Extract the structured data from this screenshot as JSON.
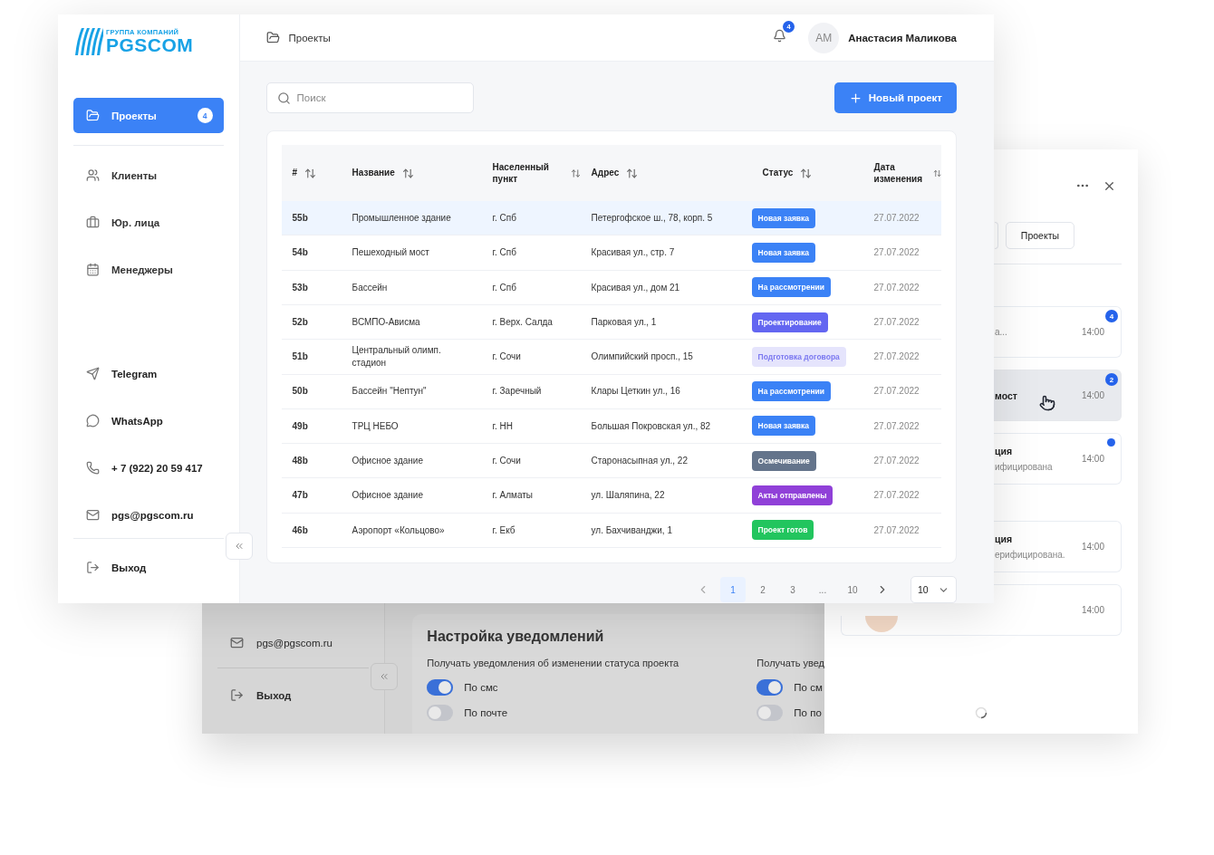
{
  "back_window": {
    "sidebar": {
      "email": "pgs@pgscom.ru",
      "logout": "Выход"
    },
    "settings": {
      "title": "Настройка уведомлений",
      "columns": [
        {
          "caption": "Получать уведомления об изменении статуса проекта",
          "toggles": [
            {
              "label": "По смс",
              "on": true
            },
            {
              "label": "По почте",
              "on": false
            }
          ]
        },
        {
          "caption": "Получать увед",
          "toggles": [
            {
              "label": "По см",
              "on": true
            },
            {
              "label": "По по",
              "on": false
            }
          ]
        }
      ]
    }
  },
  "notifications_panel": {
    "tab": "Проекты",
    "groups": [
      {
        "items": [
          {
            "text": "а...",
            "time": "14:00",
            "badge": "4",
            "unread": false,
            "hovered": false
          },
          {
            "title": "мост",
            "time": "14:00",
            "badge": "2",
            "unread": false,
            "hovered": true
          },
          {
            "title": "ция",
            "text": "ифицирована",
            "time": "14:00",
            "unread": true,
            "hovered": false
          }
        ]
      },
      {
        "items": [
          {
            "title": "ция",
            "text": "ерифицирована.",
            "time": "14:00",
            "unread": false,
            "hovered": false
          },
          {
            "time": "14:00",
            "unread": false,
            "hovered": false
          }
        ]
      }
    ]
  },
  "main_window": {
    "logo": {
      "caption": "ГРУППА КОМПАНИЙ",
      "name": "PGSCOM"
    },
    "sidebar": {
      "nav": [
        {
          "label": "Проекты",
          "badge": "4",
          "selected": true
        },
        {
          "label": "Клиенты",
          "selected": false
        },
        {
          "label": "Юр. лица",
          "selected": false
        },
        {
          "label": "Менеджеры",
          "selected": false
        }
      ],
      "contacts": [
        "Telegram",
        "WhatsApp",
        "+ 7 (922) 20 59 417",
        "pgs@pgscom.ru"
      ],
      "logout": "Выход"
    },
    "header": {
      "breadcrumb": "Проекты",
      "notifications_count": "4",
      "avatar_initials": "АМ",
      "user_name": "Анастасия Маликова"
    },
    "search": {
      "placeholder": "Поиск"
    },
    "new_button": "Новый проект",
    "table": {
      "columns": [
        "#",
        "Название",
        "Населенный пункт",
        "Адрес",
        "Статус",
        "Дата изменения"
      ],
      "rows": [
        {
          "id": "55b",
          "name": "Промышленное здание",
          "city": "г. Спб",
          "address": "Петергофское ш., 78, корп. 5",
          "status": {
            "label": "Новая заявка",
            "color": "#3b82f6",
            "kind": "solid"
          },
          "date": "27.07.2022",
          "selected": true
        },
        {
          "id": "54b",
          "name": "Пешеходный мост",
          "city": "г. Спб",
          "address": "Красивая ул., стр. 7",
          "status": {
            "label": "Новая заявка",
            "color": "#3b82f6",
            "kind": "solid"
          },
          "date": "27.07.2022",
          "selected": false
        },
        {
          "id": "53b",
          "name": "Бассейн",
          "city": "г. Спб",
          "address": "Красивая ул., дом 21",
          "status": {
            "label": "На рассмотрении",
            "color": "#3b82f6",
            "kind": "solid"
          },
          "date": "27.07.2022",
          "selected": false
        },
        {
          "id": "52b",
          "name": "ВСМПО-Ависма",
          "city": "г. Верх. Салда",
          "address": "Парковая ул., 1",
          "status": {
            "label": "Проектирование",
            "color": "#6366f1",
            "kind": "solid"
          },
          "date": "27.07.2022",
          "selected": false
        },
        {
          "id": "51b",
          "name": "Центральный олимп. стадион",
          "city": "г. Сочи",
          "address": "Олимпийский просп., 15",
          "status": {
            "label": "Подготовка договора",
            "color": "#7b78f0",
            "kind": "soft"
          },
          "date": "27.07.2022",
          "selected": false
        },
        {
          "id": "50b",
          "name": "Бассейн \"Нептун\"",
          "city": "г. Заречный",
          "address": "Клары Цеткин ул., 16",
          "status": {
            "label": "На рассмотрении",
            "color": "#3b82f6",
            "kind": "solid"
          },
          "date": "27.07.2022",
          "selected": false
        },
        {
          "id": "49b",
          "name": "ТРЦ НЕБО",
          "city": "г. НН",
          "address": "Большая Покровская ул., 82",
          "status": {
            "label": "Новая заявка",
            "color": "#3b82f6",
            "kind": "solid"
          },
          "date": "27.07.2022",
          "selected": false
        },
        {
          "id": "48b",
          "name": "Офисное здание",
          "city": "г. Сочи",
          "address": "Старонасыпная ул., 22",
          "status": {
            "label": "Осмечивание",
            "color": "#64748b",
            "kind": "solid"
          },
          "date": "27.07.2022",
          "selected": false
        },
        {
          "id": "47b",
          "name": "Офисное здание",
          "city": "г. Алматы",
          "address": "ул. Шаляпина, 22",
          "status": {
            "label": "Акты отправлены",
            "color": "#9040d8",
            "kind": "solid"
          },
          "date": "27.07.2022",
          "selected": false
        },
        {
          "id": "46b",
          "name": "Аэропорт «Кольцово»",
          "city": "г. Екб",
          "address": "ул. Бахчиванджи, 1",
          "status": {
            "label": "Проект готов",
            "color": "#22c55e",
            "kind": "solid"
          },
          "date": "27.07.2022",
          "selected": false
        }
      ]
    },
    "pagination": {
      "pages": [
        {
          "label": "1",
          "selected": true
        },
        {
          "label": "2",
          "selected": false
        },
        {
          "label": "3",
          "selected": false
        },
        {
          "label": "...",
          "selected": false
        },
        {
          "label": "10",
          "selected": false
        }
      ],
      "page_size": "10"
    }
  }
}
